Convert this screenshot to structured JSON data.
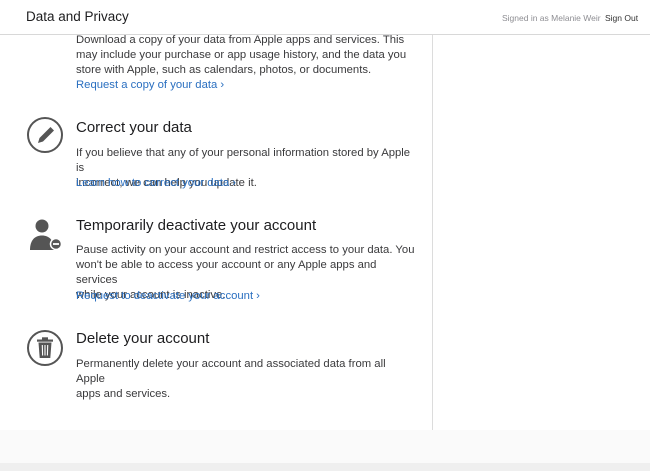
{
  "header": {
    "title": "Data and Privacy",
    "signed_in": "Signed in as Melanie Weir",
    "sign_out": "Sign Out"
  },
  "sections": [
    {
      "icon": "download-icon",
      "heading": "",
      "lines": [
        "Download a copy of your data from Apple apps and services. This",
        "may include your purchase or app usage history, and the data you",
        "store with Apple, such as calendars, photos, or documents."
      ],
      "link": "Request a copy of your data"
    },
    {
      "icon": "pencil-icon",
      "heading": "Correct your data",
      "lines": [
        "If you believe that any of your personal information stored by Apple is",
        "incorrect, we can help you update it."
      ],
      "link": "Learn how to correct your data"
    },
    {
      "icon": "person-minus-icon",
      "heading": "Temporarily deactivate your account",
      "lines": [
        "Pause activity on your account and restrict access to your data. You",
        "won't be able to access your account or any Apple apps and services",
        "while your account is inactive."
      ],
      "link": "Request to deactivate your account"
    },
    {
      "icon": "trash-icon",
      "heading": "Delete your account",
      "lines": [
        "Permanently delete your account and associated data from all Apple",
        "apps and services."
      ],
      "link": ""
    }
  ],
  "chevron": "›",
  "colors": {
    "link": "#2a6fc0",
    "text": "#1d1d1f",
    "body": "#3a3a3c",
    "icon": "#555555"
  }
}
